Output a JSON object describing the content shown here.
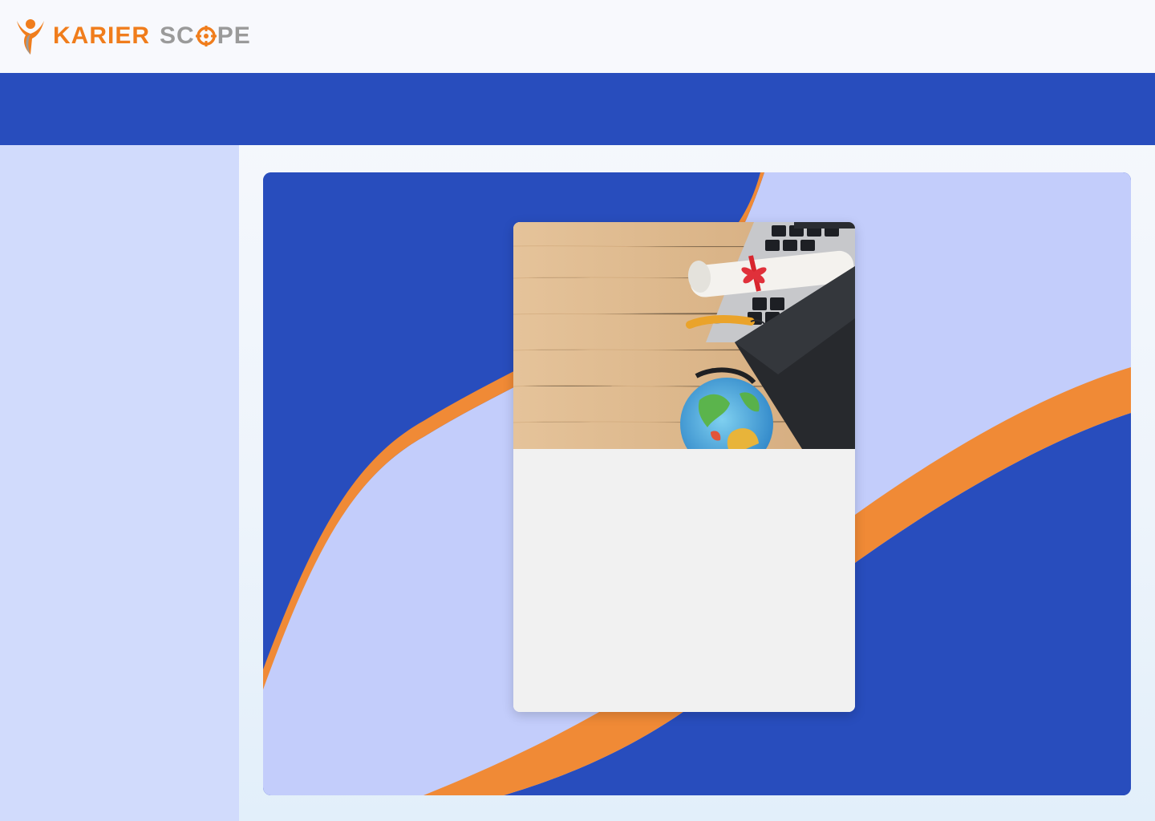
{
  "brand": {
    "name_part1": "KARIER",
    "name_part2_prefix": "SC",
    "name_part2_suffix": "PE",
    "colors": {
      "orange": "#f07d1c",
      "gray": "#9a9a9a"
    }
  },
  "theme": {
    "primary_blue": "#284dbd",
    "light_lavender": "#c3cdfb",
    "sidebar_bg": "#d1dbfc",
    "accent_orange": "#f08a36"
  },
  "card": {
    "hero_image": "graduation-desk-illustration",
    "body_text": ""
  }
}
